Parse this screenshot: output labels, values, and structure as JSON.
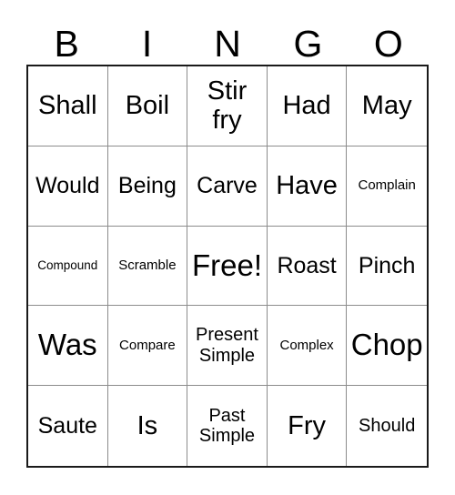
{
  "card": {
    "title_letters": [
      "B",
      "I",
      "N",
      "G",
      "O"
    ],
    "free_space_label": "Free!",
    "grid": {
      "columns": 5,
      "rows": 5,
      "border_color": "#1a1a1a",
      "line_color": "#8c8c8c",
      "background_color": "#ffffff",
      "text_color": "#000000"
    },
    "cells": [
      {
        "text": "Shall",
        "size": "lg",
        "lines": 1
      },
      {
        "text": "Boil",
        "size": "lg",
        "lines": 1
      },
      {
        "text": "Stir fry",
        "size": "lg",
        "lines": 2
      },
      {
        "text": "Had",
        "size": "lg",
        "lines": 1
      },
      {
        "text": "May",
        "size": "lg",
        "lines": 1
      },
      {
        "text": "Would",
        "size": "md",
        "lines": 1
      },
      {
        "text": "Being",
        "size": "md",
        "lines": 1
      },
      {
        "text": "Carve",
        "size": "md",
        "lines": 1
      },
      {
        "text": "Have",
        "size": "lg",
        "lines": 1
      },
      {
        "text": "Complain",
        "size": "xs",
        "lines": 1
      },
      {
        "text": "Compound",
        "size": "xxs",
        "lines": 1
      },
      {
        "text": "Scramble",
        "size": "xs",
        "lines": 1
      },
      {
        "text": "Free!",
        "size": "xl",
        "lines": 1
      },
      {
        "text": "Roast",
        "size": "md",
        "lines": 1
      },
      {
        "text": "Pinch",
        "size": "md",
        "lines": 1
      },
      {
        "text": "Was",
        "size": "xl",
        "lines": 1
      },
      {
        "text": "Compare",
        "size": "xs",
        "lines": 1
      },
      {
        "text": "Present Simple",
        "size": "sm",
        "lines": 2
      },
      {
        "text": "Complex",
        "size": "xs",
        "lines": 1
      },
      {
        "text": "Chop",
        "size": "xl",
        "lines": 1
      },
      {
        "text": "Saute",
        "size": "md",
        "lines": 1
      },
      {
        "text": "Is",
        "size": "lg",
        "lines": 1
      },
      {
        "text": "Past Simple",
        "size": "sm",
        "lines": 2
      },
      {
        "text": "Fry",
        "size": "lg",
        "lines": 1
      },
      {
        "text": "Should",
        "size": "sm",
        "lines": 1
      }
    ]
  }
}
